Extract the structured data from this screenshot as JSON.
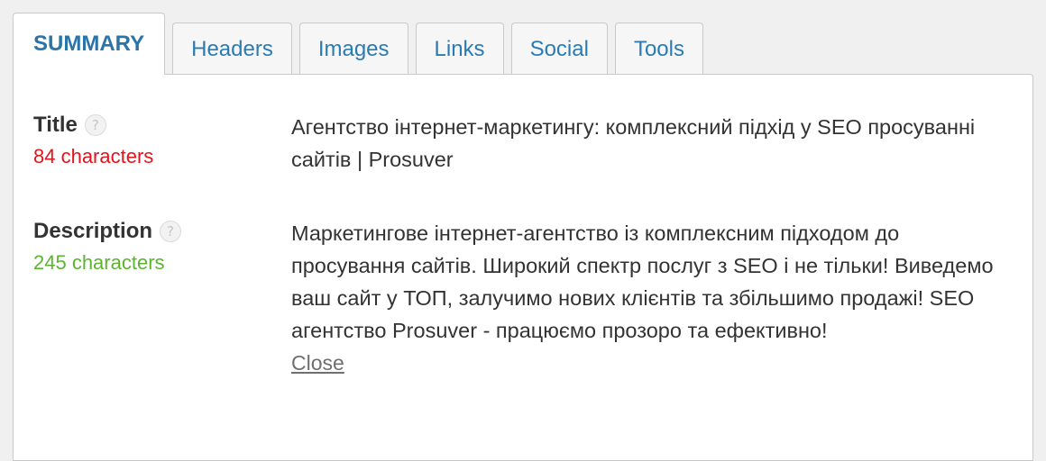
{
  "tabs": [
    {
      "label": "SUMMARY",
      "active": true
    },
    {
      "label": "Headers",
      "active": false
    },
    {
      "label": "Images",
      "active": false
    },
    {
      "label": "Links",
      "active": false
    },
    {
      "label": "Social",
      "active": false
    },
    {
      "label": "Tools",
      "active": false
    }
  ],
  "summary": {
    "title": {
      "label": "Title",
      "help": "?",
      "count": "84 characters",
      "status": "bad",
      "value": "Агентство інтернет-маркетингу: комплексний підхід у SEO просуванні сайтів | Prosuver"
    },
    "description": {
      "label": "Description",
      "help": "?",
      "count": "245 characters",
      "status": "good",
      "value": "Маркетингове інтернет-агентство із комплексним підходом до просування сайтів. Широкий спектр послуг з SEO і не тільки! Виведемо ваш сайт у ТОП, залучимо нових клієнтів та збільшимо продажі! SEO агентство Prosuver - працюємо прозоро та ефективно!",
      "close_label": "Close"
    }
  },
  "colors": {
    "tab_text": "#2a7bb3",
    "count_bad": "#e3141b",
    "count_good": "#5cb531"
  }
}
